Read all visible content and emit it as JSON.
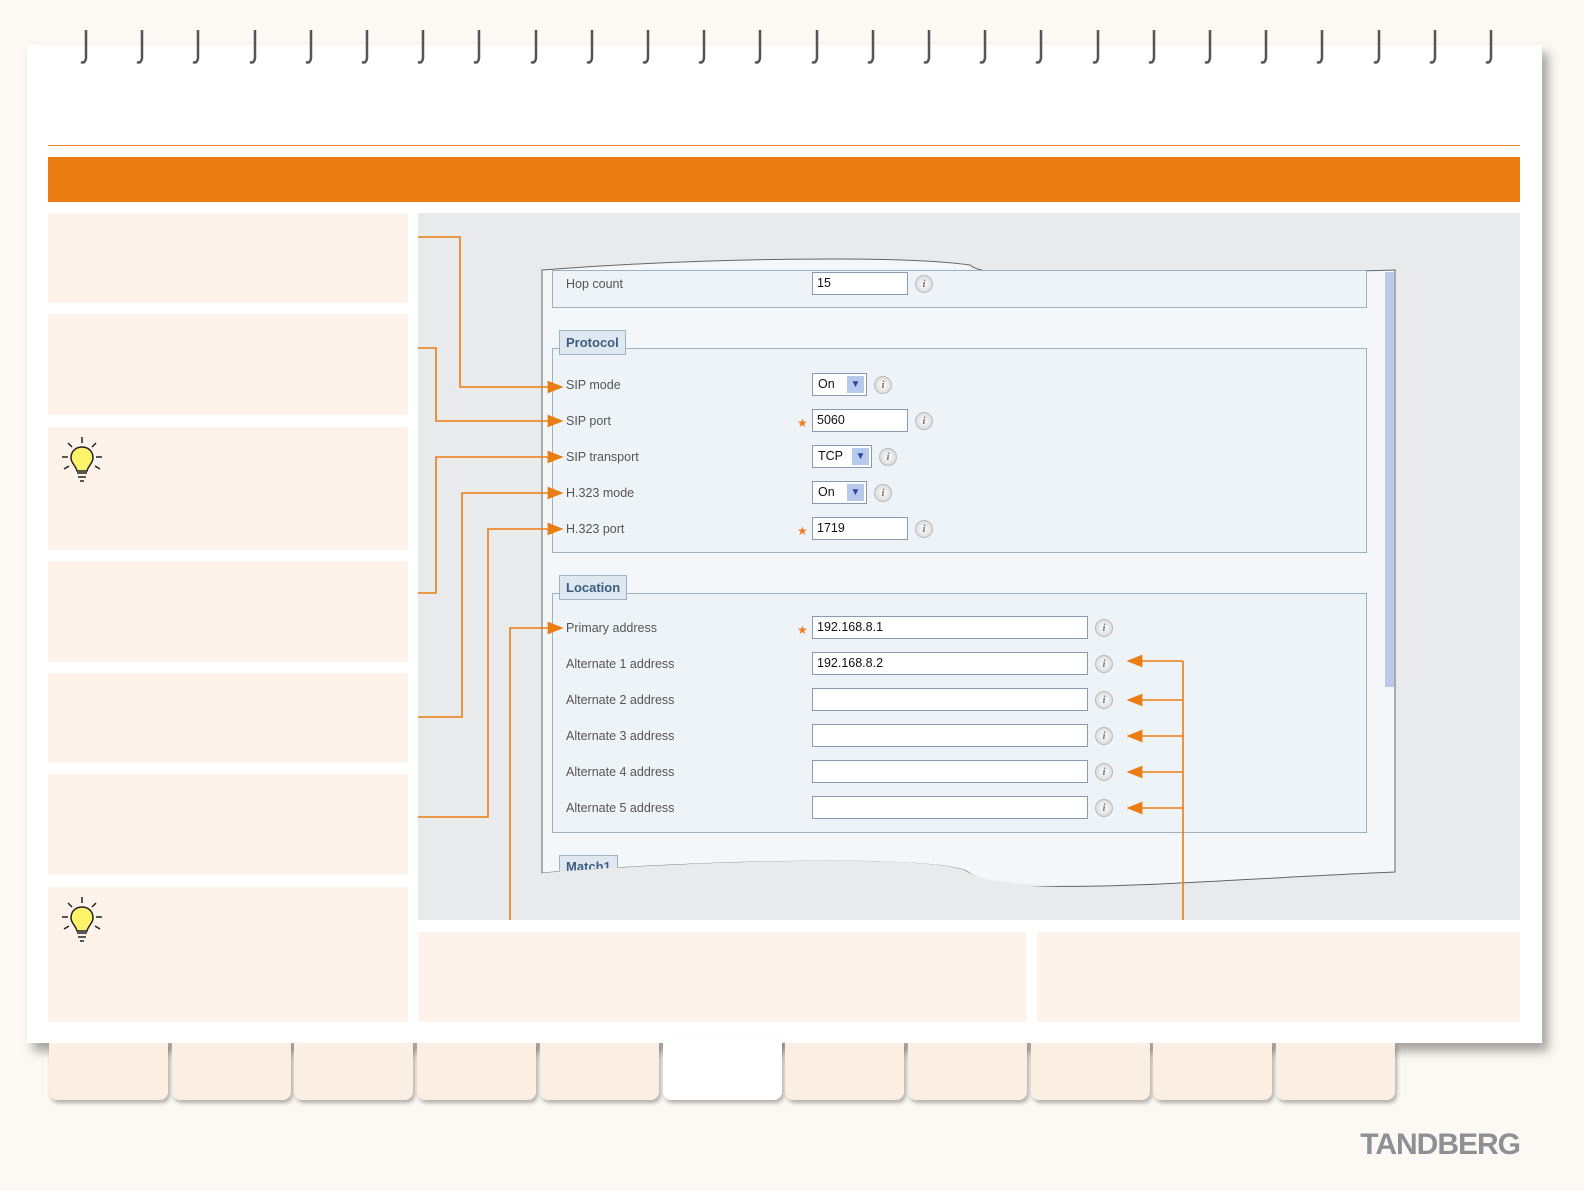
{
  "brand": {
    "logo_text": "TANDBERG",
    "accent": "#eb7c12"
  },
  "tabs": {
    "count": 11,
    "active_index": 5
  },
  "form": {
    "hop_count": {
      "label": "Hop count",
      "value": "15"
    },
    "protocol": {
      "legend": "Protocol",
      "rows": [
        {
          "label": "SIP mode",
          "type": "select",
          "value": "On",
          "required": false
        },
        {
          "label": "SIP port",
          "type": "input",
          "value": "5060",
          "required": true
        },
        {
          "label": "SIP transport",
          "type": "select",
          "value": "TCP",
          "required": false
        },
        {
          "label": "H.323 mode",
          "type": "select",
          "value": "On",
          "required": false
        },
        {
          "label": "H.323 port",
          "type": "input",
          "value": "1719",
          "required": true
        }
      ]
    },
    "location": {
      "legend": "Location",
      "rows": [
        {
          "label": "Primary address",
          "value": "192.168.8.1",
          "required": true
        },
        {
          "label": "Alternate 1 address",
          "value": "192.168.8.2",
          "required": false
        },
        {
          "label": "Alternate 2 address",
          "value": "",
          "required": false
        },
        {
          "label": "Alternate 3 address",
          "value": "",
          "required": false
        },
        {
          "label": "Alternate 4 address",
          "value": "",
          "required": false
        },
        {
          "label": "Alternate 5 address",
          "value": "",
          "required": false
        }
      ]
    },
    "next_legend": "Match1",
    "info_glyph": "i",
    "required_glyph": "★"
  }
}
